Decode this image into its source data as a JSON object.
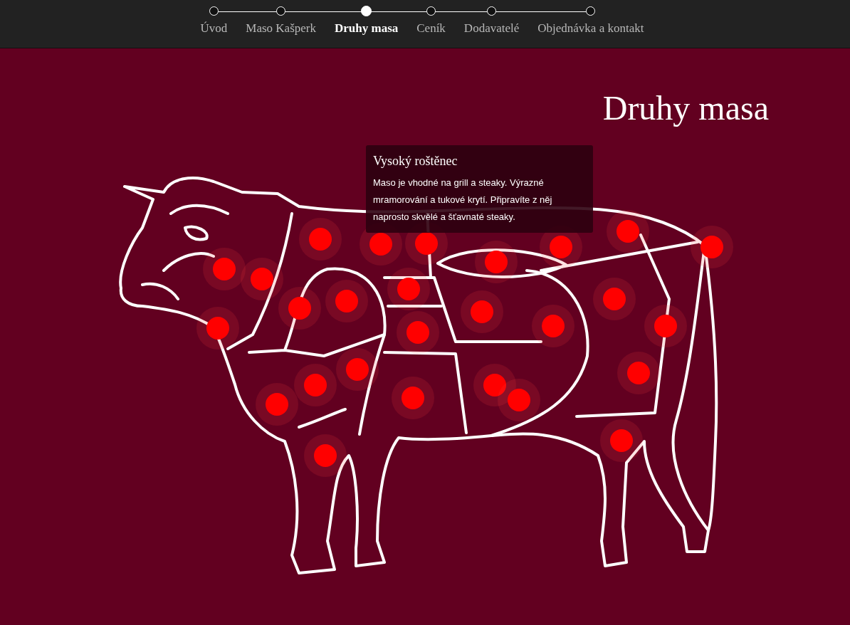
{
  "nav": {
    "steps": [
      {
        "label": "Úvod",
        "selected": false
      },
      {
        "label": "Maso Kašperk",
        "selected": false
      },
      {
        "label": "Druhy masa",
        "selected": true
      },
      {
        "label": "Ceník",
        "selected": false
      },
      {
        "label": "Dodavatelé",
        "selected": false
      },
      {
        "label": "Objednávka a kontakt",
        "selected": false
      }
    ]
  },
  "page": {
    "title": "Druhy masa"
  },
  "tooltip": {
    "title": "Vysoký roštěnec",
    "text": "Maso je vhodné na grill a steaky. Výrazné mramorování a tukové krytí. Připravíte z něj naprosto skvělé a šťavnaté steaky."
  }
}
